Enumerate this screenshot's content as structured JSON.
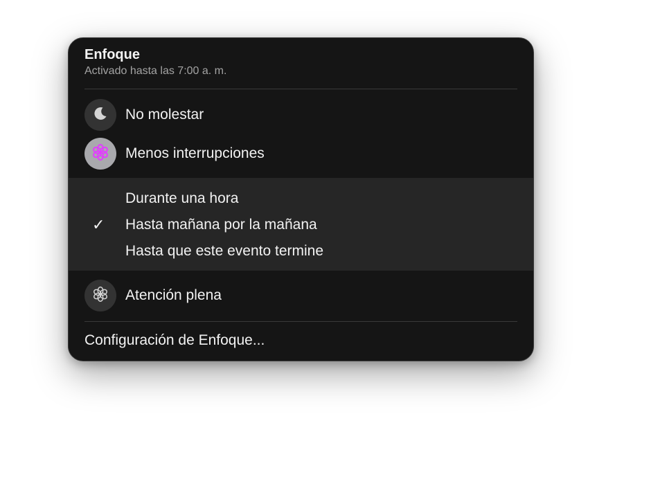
{
  "focus_menu": {
    "title": "Enfoque",
    "subtitle": "Activado hasta las 7:00 a. m.",
    "modes": [
      {
        "label": "No molestar",
        "icon": "moon-icon",
        "active": false
      },
      {
        "label": "Menos interrupciones",
        "icon": "flower-icon",
        "active": true
      },
      {
        "label": "Atención plena",
        "icon": "mindfulness-flower-icon",
        "active": false
      }
    ],
    "duration_options": [
      {
        "label": "Durante una hora",
        "checked": false
      },
      {
        "label": "Hasta mañana por la mañana",
        "checked": true
      },
      {
        "label": "Hasta que este evento termine",
        "checked": false
      }
    ],
    "checkmark": "✓",
    "settings_label": "Configuración de Enfoque..."
  },
  "colors": {
    "panel_bg": "#151515",
    "submenu_bg": "#262626",
    "accent": "#e040fb"
  }
}
